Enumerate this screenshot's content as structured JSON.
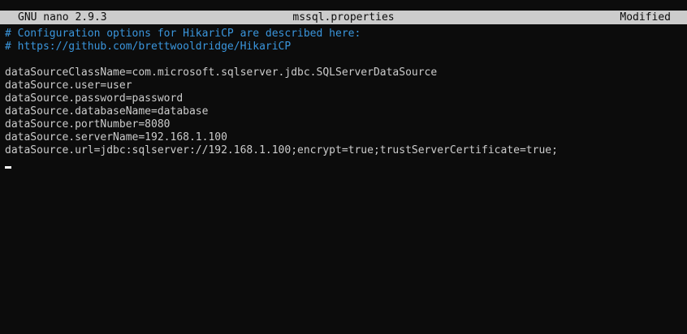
{
  "header": {
    "app_version": "GNU nano 2.9.3",
    "filename": "mssql.properties",
    "status": "Modified"
  },
  "colors": {
    "background": "#0c0c0c",
    "header_bg": "#cccccc",
    "text": "#cccccc",
    "comment": "#3a96dd",
    "cursor": "#ffffff"
  },
  "editor": {
    "lines": [
      "# Configuration options for HikariCP are described here:",
      "# https://github.com/brettwooldridge/HikariCP",
      "",
      "dataSourceClassName=com.microsoft.sqlserver.jdbc.SQLServerDataSource",
      "dataSource.user=user",
      "dataSource.password=password",
      "dataSource.databaseName=database",
      "dataSource.portNumber=8080",
      "dataSource.serverName=192.168.1.100",
      "dataSource.url=jdbc:sqlserver://192.168.1.100;encrypt=true;trustServerCertificate=true;"
    ]
  }
}
